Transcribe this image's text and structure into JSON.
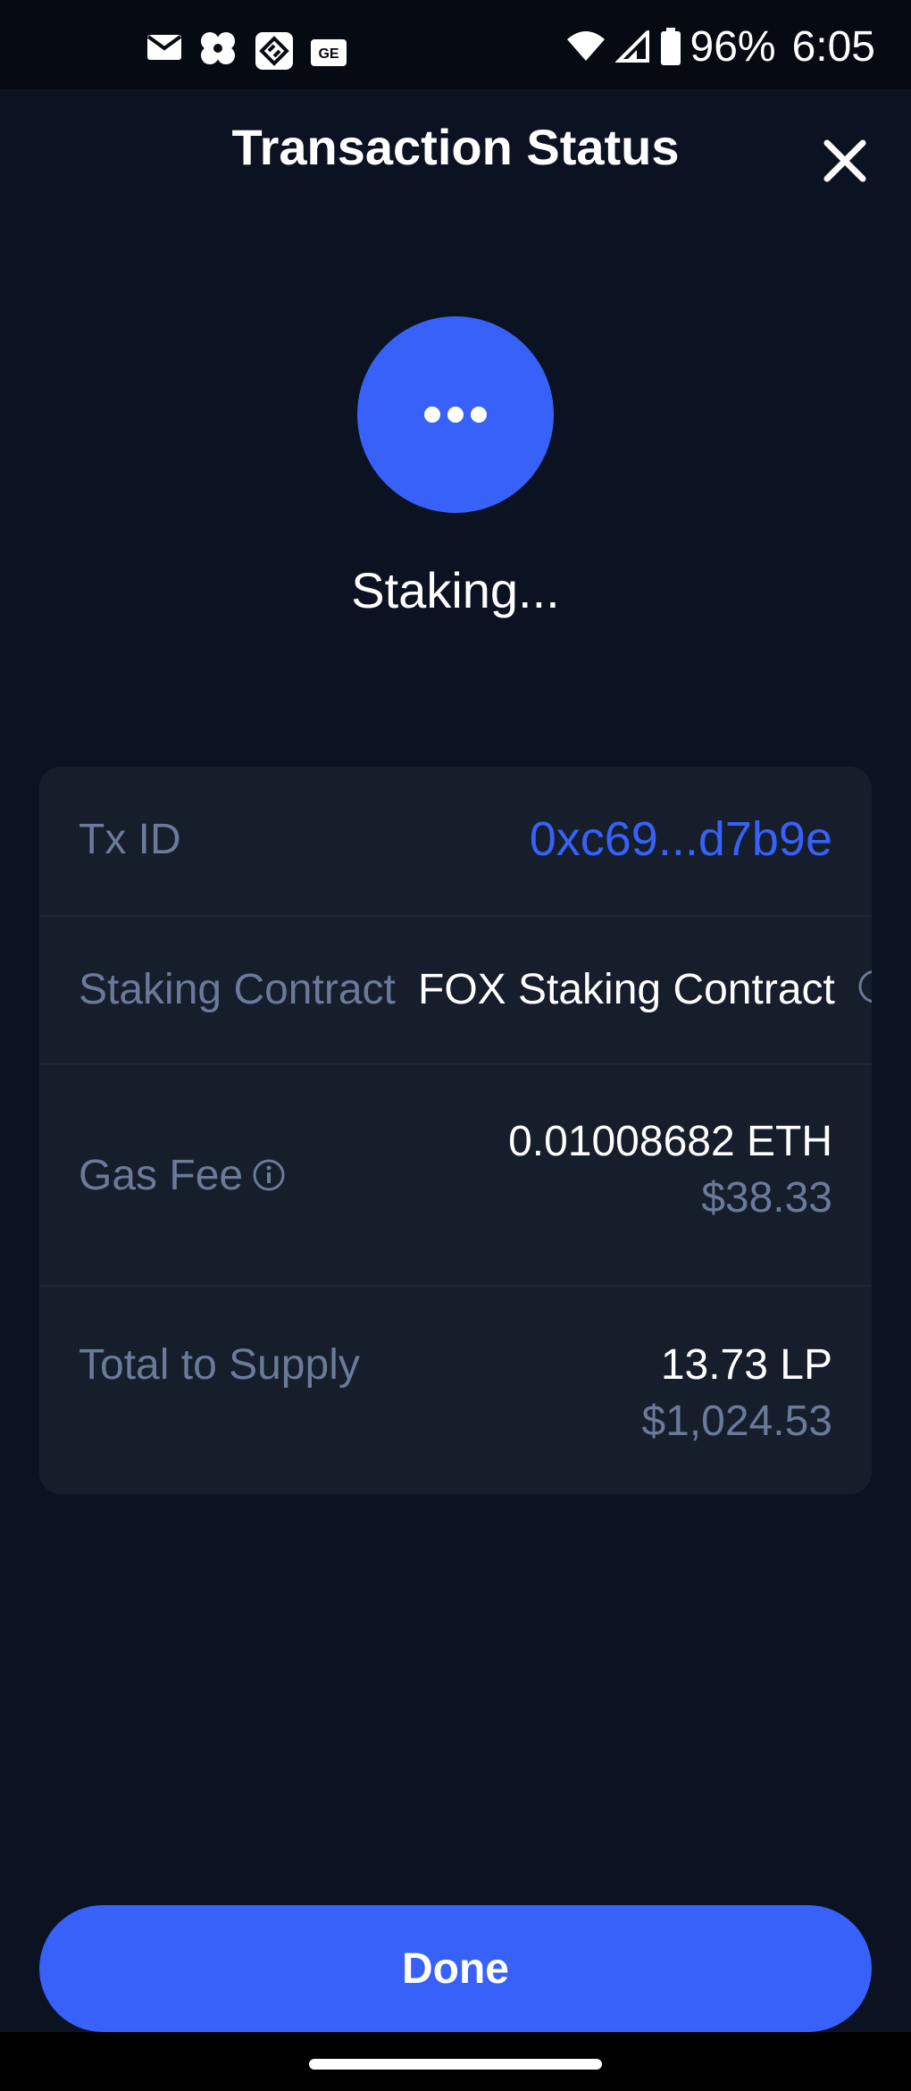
{
  "status_bar": {
    "battery": "96%",
    "time": "6:05",
    "notification_icons": [
      "mail-icon",
      "pinwheel-app-icon",
      "ledger-app-icon",
      "ge-app-icon"
    ]
  },
  "header": {
    "title": "Transaction Status",
    "close_icon": "close-icon"
  },
  "status": {
    "icon": "ellipsis-icon",
    "text": "Staking..."
  },
  "details": {
    "tx_id": {
      "label": "Tx ID",
      "value": "0xc69...d7b9e"
    },
    "staking_contract": {
      "label": "Staking Contract",
      "value": "FOX Staking Contract"
    },
    "gas_fee": {
      "label": "Gas Fee",
      "crypto": "0.01008682 ETH",
      "fiat": "$38.33"
    },
    "total_supply": {
      "label": "Total to Supply",
      "crypto": "13.73 LP",
      "fiat": "$1,024.53"
    }
  },
  "done_button": {
    "label": "Done"
  },
  "colors": {
    "background": "#0b1221",
    "card": "#161d2b",
    "accent": "#3761f9",
    "muted_text": "#6a7a98"
  }
}
